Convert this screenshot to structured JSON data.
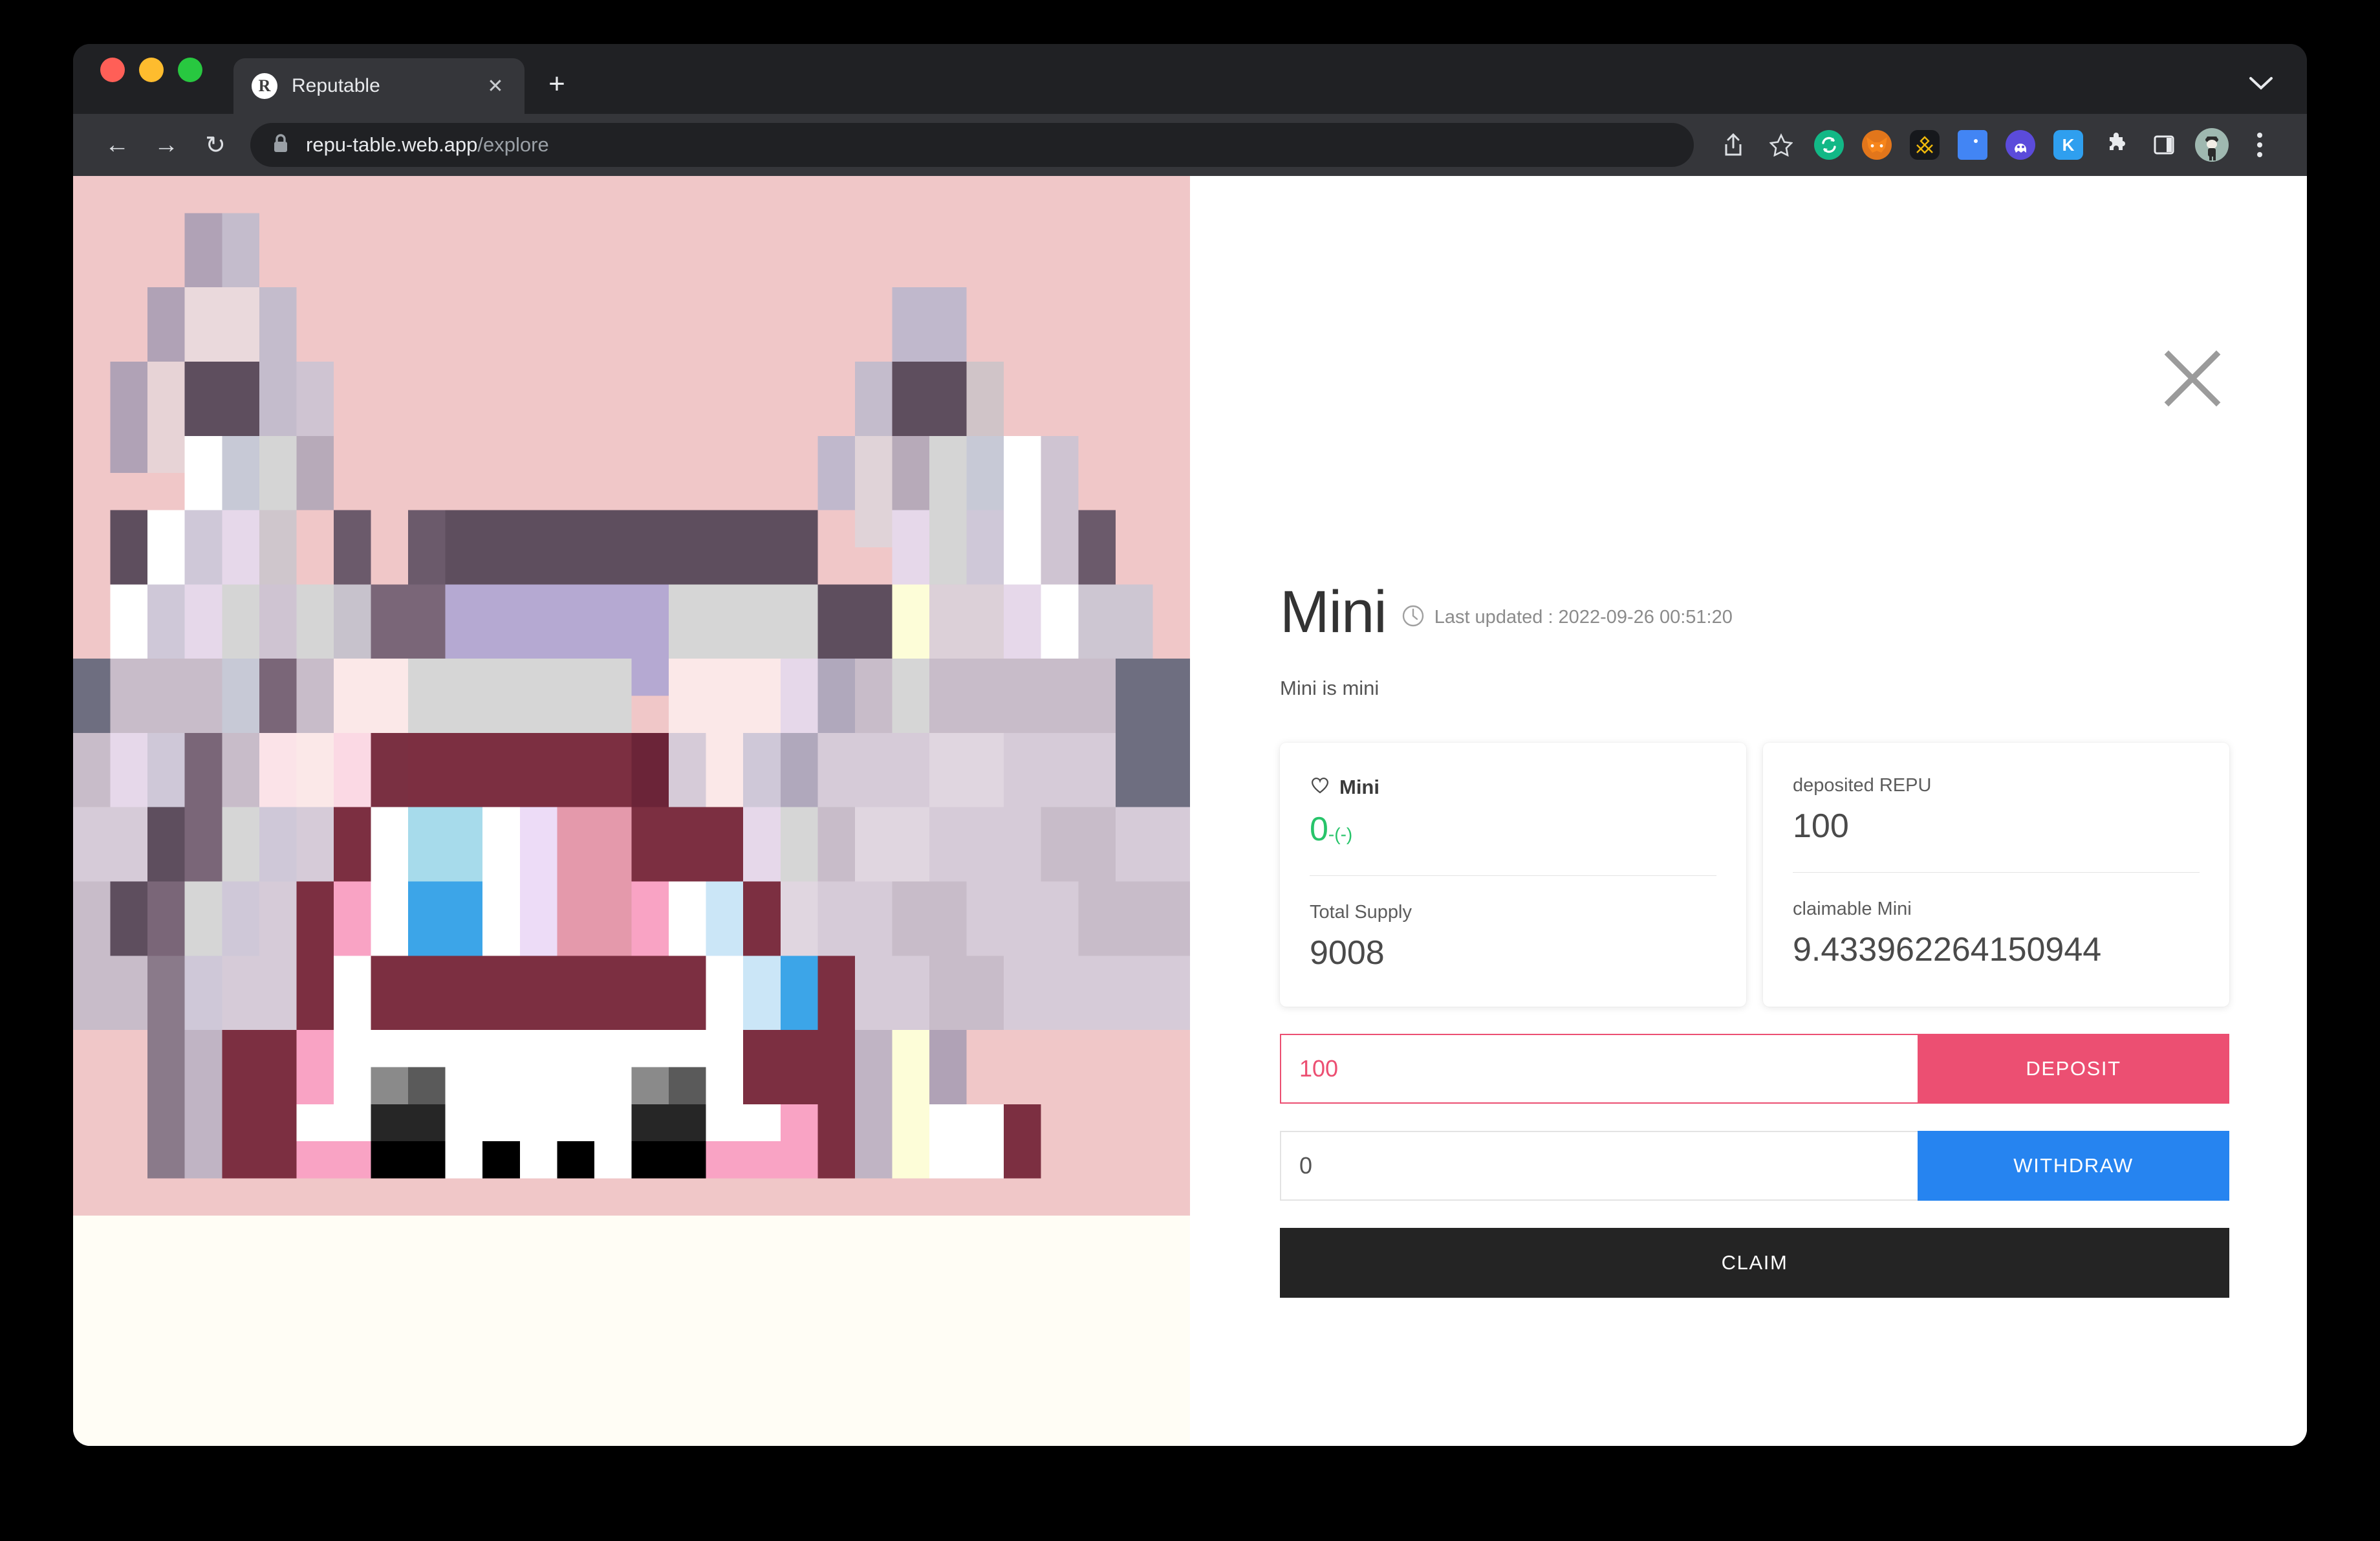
{
  "browser": {
    "tab": {
      "title": "Reputable",
      "favicon_letter": "R",
      "close_label": "✕"
    },
    "new_tab_label": "+",
    "back_label": "←",
    "forward_label": "→",
    "reload_label": "↻",
    "url_domain": "repu-table.web.app",
    "url_path": "/explore",
    "extensions": [
      {
        "name": "share-icon",
        "label": ""
      },
      {
        "name": "bookmark-star-icon",
        "label": ""
      },
      {
        "name": "extension-green-sync-icon",
        "label": ""
      },
      {
        "name": "extension-metamask-icon",
        "label": ""
      },
      {
        "name": "extension-binance-icon",
        "label": ""
      },
      {
        "name": "extension-blue-icon",
        "label": ""
      },
      {
        "name": "extension-phantom-ghost-icon",
        "label": ""
      },
      {
        "name": "extension-kaikas-icon",
        "label": "K"
      },
      {
        "name": "extensions-puzzle-icon",
        "label": ""
      },
      {
        "name": "side-panel-icon",
        "label": ""
      },
      {
        "name": "profile-avatar",
        "label": ""
      },
      {
        "name": "browser-menu-icon",
        "label": ""
      }
    ]
  },
  "nft": {
    "background_color": "#f0c7c8",
    "canvas_color": "#fffdf5",
    "alt": "pixel-art cat character"
  },
  "detail": {
    "close_label": "✕",
    "title": "Mini",
    "last_updated": "Last updated : 2022-09-26 00:51:20",
    "description": "Mini is mini",
    "cards": [
      {
        "rows": [
          {
            "label": "Mini",
            "icon": "heart-icon",
            "value": "0",
            "value_sub": "-(-)",
            "value_color": "#27c46a",
            "bold_label": true
          },
          {
            "label": "Total Supply",
            "value": "9008",
            "value_color": "#4a4a4a",
            "bold_label": false
          }
        ]
      },
      {
        "rows": [
          {
            "label": "deposited REPU",
            "value": "100",
            "value_color": "#4a4a4a",
            "bold_label": false
          },
          {
            "label": "claimable Mini",
            "value": "9.433962264150944",
            "value_color": "#4a4a4a",
            "bold_label": false
          }
        ]
      }
    ],
    "deposit": {
      "value": "100",
      "placeholder": "0",
      "button_label": "DEPOSIT",
      "color": "#ec4f72"
    },
    "withdraw": {
      "value": "0",
      "placeholder": "0",
      "button_label": "WITHDRAW",
      "color": "#2684f0"
    },
    "claim": {
      "button_label": "CLAIM",
      "color": "#242424"
    }
  }
}
